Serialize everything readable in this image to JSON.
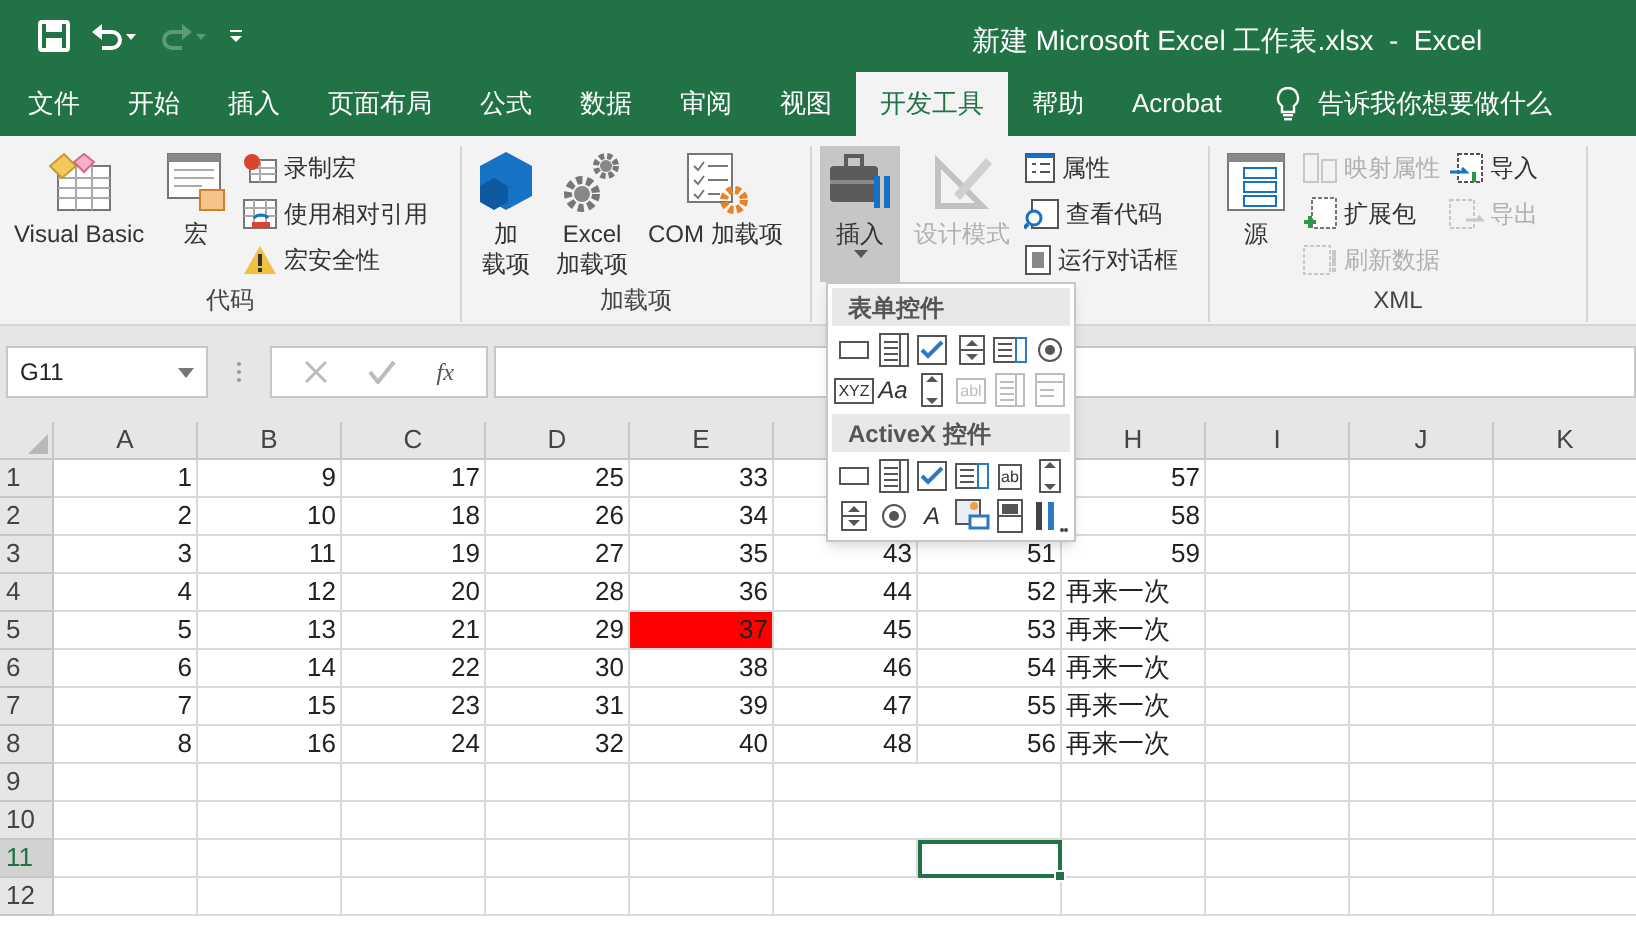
{
  "quick_access": [
    {
      "kind": "save",
      "disabled": false
    },
    {
      "kind": "undo",
      "disabled": false
    },
    {
      "kind": "redo",
      "disabled": true
    },
    {
      "kind": "customize",
      "disabled": false
    }
  ],
  "window": {
    "title": "新建 Microsoft Excel 工作表.xlsx  -  Excel"
  },
  "tabs": [
    {
      "label": "文件",
      "selected": false
    },
    {
      "label": "开始",
      "selected": false
    },
    {
      "label": "插入",
      "selected": false
    },
    {
      "label": "页面布局",
      "selected": false
    },
    {
      "label": "公式",
      "selected": false
    },
    {
      "label": "数据",
      "selected": false
    },
    {
      "label": "审阅",
      "selected": false
    },
    {
      "label": "视图",
      "selected": false
    },
    {
      "label": "开发工具",
      "selected": true
    },
    {
      "label": "帮助",
      "selected": false
    },
    {
      "label": "Acrobat",
      "selected": false
    }
  ],
  "tell_me": {
    "placeholder": "告诉我你想要做什么"
  },
  "ribbon_groups": [
    {
      "label": "代码",
      "items": [
        {
          "kind": "large",
          "lines": [
            "Visual Basic"
          ],
          "disabled": false
        },
        {
          "kind": "large",
          "lines": [
            "宏"
          ],
          "disabled": false
        },
        {
          "kind": "stack",
          "buttons": [
            {
              "label": "录制宏",
              "disabled": false
            },
            {
              "label": "使用相对引用",
              "disabled": false
            },
            {
              "label": "宏安全性",
              "disabled": false
            }
          ]
        }
      ]
    },
    {
      "label": "加载项",
      "items": [
        {
          "kind": "large",
          "lines": [
            "加",
            "载项"
          ],
          "disabled": false
        },
        {
          "kind": "large",
          "lines": [
            "Excel",
            "加载项"
          ],
          "disabled": false
        },
        {
          "kind": "large",
          "lines": [
            "COM 加载项"
          ],
          "disabled": false
        }
      ]
    },
    {
      "items": [
        {
          "kind": "large",
          "lines": [
            "插入"
          ],
          "disabled": false,
          "pressed": true,
          "caret": true
        },
        {
          "kind": "large",
          "lines": [
            "设计模式"
          ],
          "disabled": true
        },
        {
          "kind": "stack",
          "buttons": [
            {
              "label": "属性",
              "disabled": false
            },
            {
              "label": "查看代码",
              "disabled": false
            },
            {
              "label": "运行对话框",
              "disabled": false
            }
          ]
        }
      ]
    },
    {
      "label": "XML",
      "items": [
        {
          "kind": "large",
          "lines": [
            "源"
          ],
          "disabled": false
        },
        {
          "kind": "stack",
          "buttons": [
            {
              "label": "映射属性",
              "disabled": true
            },
            {
              "label": "扩展包",
              "disabled": false
            },
            {
              "label": "刷新数据",
              "disabled": true
            }
          ]
        },
        {
          "kind": "stack",
          "buttons": [
            {
              "label": "导入",
              "disabled": false
            },
            {
              "label": "导出",
              "disabled": true
            }
          ]
        }
      ]
    }
  ],
  "insert_menu": {
    "sections": [
      {
        "title": "表单控件",
        "controls": [
          {
            "kind": "button",
            "disabled": false
          },
          {
            "kind": "combo",
            "disabled": false
          },
          {
            "kind": "checkbox",
            "disabled": false
          },
          {
            "kind": "spinner",
            "disabled": false
          },
          {
            "kind": "listbox",
            "disabled": false
          },
          {
            "kind": "radio",
            "disabled": false
          },
          {
            "kind": "group",
            "glyph": "XYZ",
            "disabled": false
          },
          {
            "kind": "label",
            "glyph": "Aa",
            "disabled": false
          },
          {
            "kind": "scrollbar",
            "disabled": false
          },
          {
            "kind": "textfield",
            "glyph": "abl",
            "disabled": true
          },
          {
            "kind": "combo",
            "disabled": true
          },
          {
            "kind": "dropcombo",
            "disabled": true
          }
        ]
      },
      {
        "title": "ActiveX 控件",
        "controls": [
          {
            "kind": "button",
            "disabled": false
          },
          {
            "kind": "combo",
            "disabled": false
          },
          {
            "kind": "checkbox",
            "disabled": false
          },
          {
            "kind": "listbox",
            "disabled": false
          },
          {
            "kind": "textfield",
            "glyph": "ab",
            "disabled": false
          },
          {
            "kind": "scrollbar",
            "disabled": false
          },
          {
            "kind": "spinner",
            "disabled": false
          },
          {
            "kind": "radio",
            "disabled": false
          },
          {
            "kind": "label",
            "glyph": "A",
            "disabled": false
          },
          {
            "kind": "image",
            "disabled": false
          },
          {
            "kind": "toggle",
            "disabled": false
          },
          {
            "kind": "more",
            "disabled": false
          }
        ]
      }
    ]
  },
  "name_box": {
    "value": "G11"
  },
  "formula_bar": {
    "function_label": "fx"
  },
  "sheet": {
    "columns": [
      "A",
      "B",
      "C",
      "D",
      "E",
      null,
      null,
      "H",
      "I",
      "J",
      "K"
    ],
    "rows": [
      {
        "header": "1",
        "selected": false,
        "cells": [
          "1",
          "9",
          "17",
          "25",
          "33",
          null,
          null,
          "57"
        ]
      },
      {
        "header": "2",
        "selected": false,
        "cells": [
          "2",
          "10",
          "18",
          "26",
          "34",
          null,
          null,
          "58"
        ]
      },
      {
        "header": "3",
        "selected": false,
        "cells": [
          "3",
          "11",
          "19",
          "27",
          "35",
          "43",
          "51",
          "59"
        ]
      },
      {
        "header": "4",
        "selected": false,
        "cells": [
          "4",
          "12",
          "20",
          "28",
          "36",
          "44",
          "52",
          "再来一次"
        ]
      },
      {
        "header": "5",
        "selected": false,
        "cells": [
          "5",
          "13",
          "21",
          "29",
          {
            "text": "37",
            "color": "#ff0000"
          },
          "45",
          "53",
          "再来一次"
        ]
      },
      {
        "header": "6",
        "selected": false,
        "cells": [
          "6",
          "14",
          "22",
          "30",
          "38",
          "46",
          "54",
          "再来一次"
        ]
      },
      {
        "header": "7",
        "selected": false,
        "cells": [
          "7",
          "15",
          "23",
          "31",
          "39",
          "47",
          "55",
          "再来一次"
        ]
      },
      {
        "header": "8",
        "selected": false,
        "cells": [
          "8",
          "16",
          "24",
          "32",
          "40",
          "48",
          "56",
          "再来一次"
        ]
      },
      {
        "header": "9",
        "selected": false,
        "cells": []
      },
      {
        "header": "10",
        "selected": false,
        "cells": []
      },
      {
        "header": "11",
        "selected": true,
        "cells": [
          null,
          null,
          null,
          null,
          null,
          null,
          {
            "active": true
          }
        ]
      },
      {
        "header": "12",
        "selected": false,
        "cells": []
      }
    ]
  }
}
